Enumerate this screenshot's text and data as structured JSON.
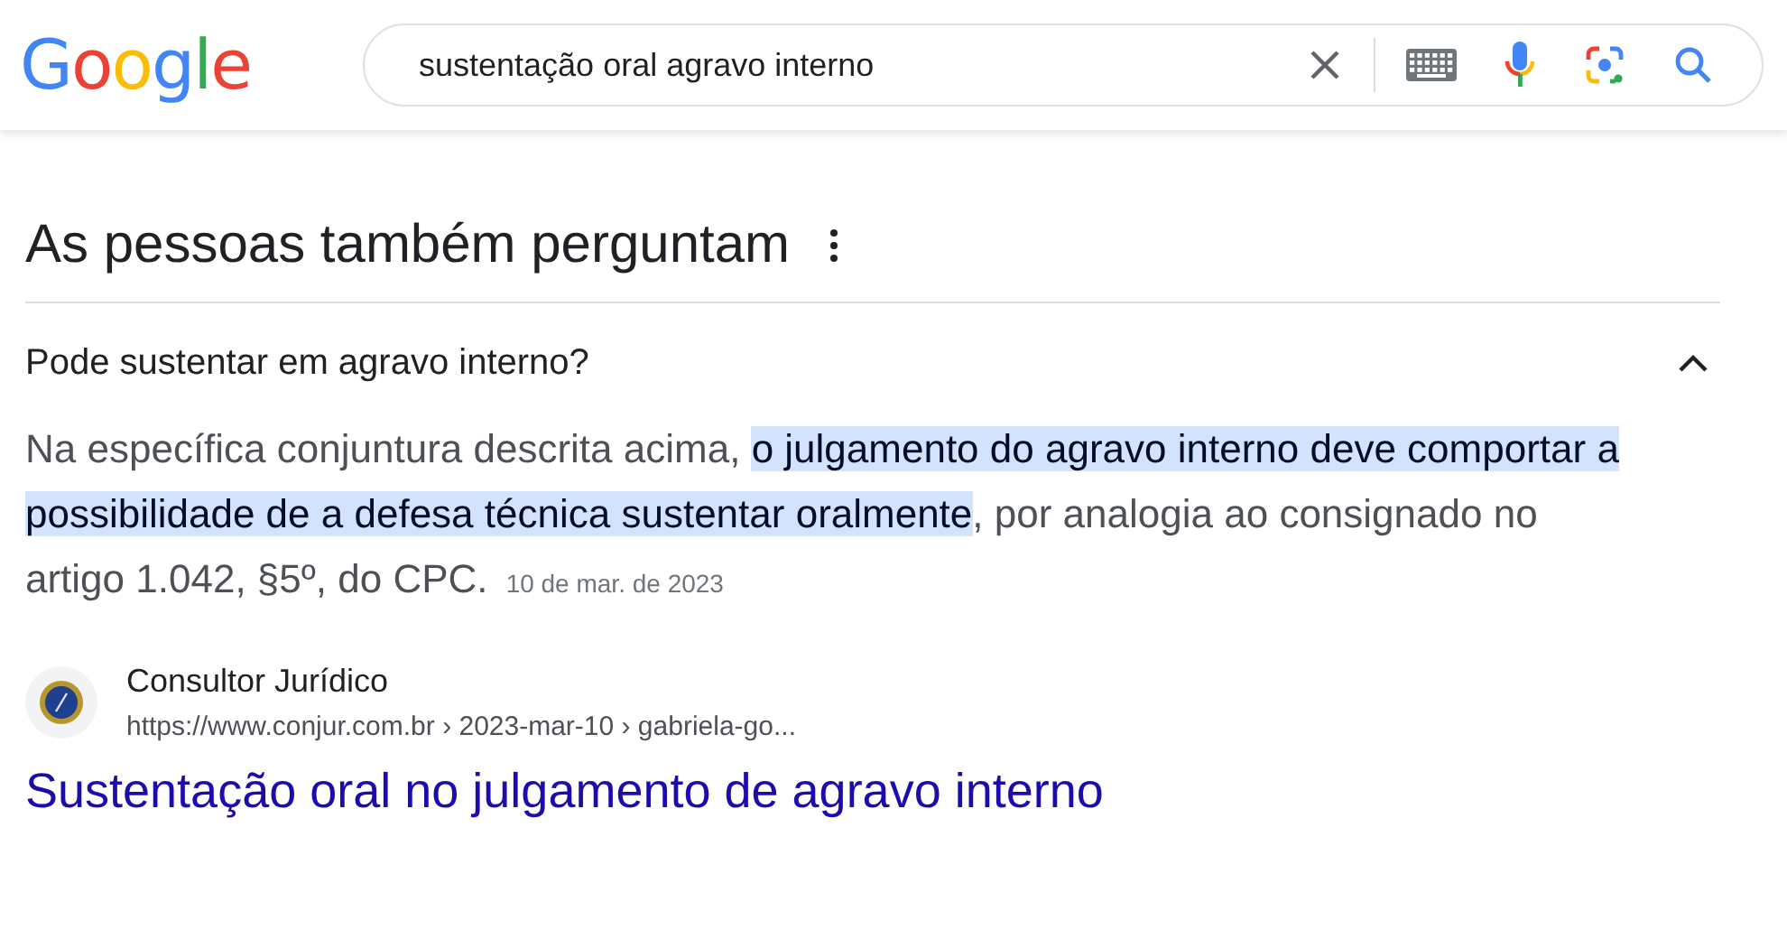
{
  "logo": "Google",
  "search": {
    "value": "sustentação oral agravo interno"
  },
  "section": {
    "title": "As pessoas também perguntam"
  },
  "question": {
    "text": "Pode sustentar em agravo interno?",
    "expanded": true
  },
  "answer": {
    "before": "Na específica conjuntura descrita acima, ",
    "highlight": "o julgamento do agravo interno deve comportar a possibilidade de a defesa técnica sustentar oralmente",
    "after": ", por analogia ao consignado no artigo 1.042, §5º, do CPC.",
    "date": "10 de mar. de 2023"
  },
  "source": {
    "name": "Consultor Jurídico",
    "url": "https://www.conjur.com.br › 2023-mar-10 › gabriela-go..."
  },
  "result": {
    "title": "Sustentação oral no julgamento de agravo interno"
  }
}
